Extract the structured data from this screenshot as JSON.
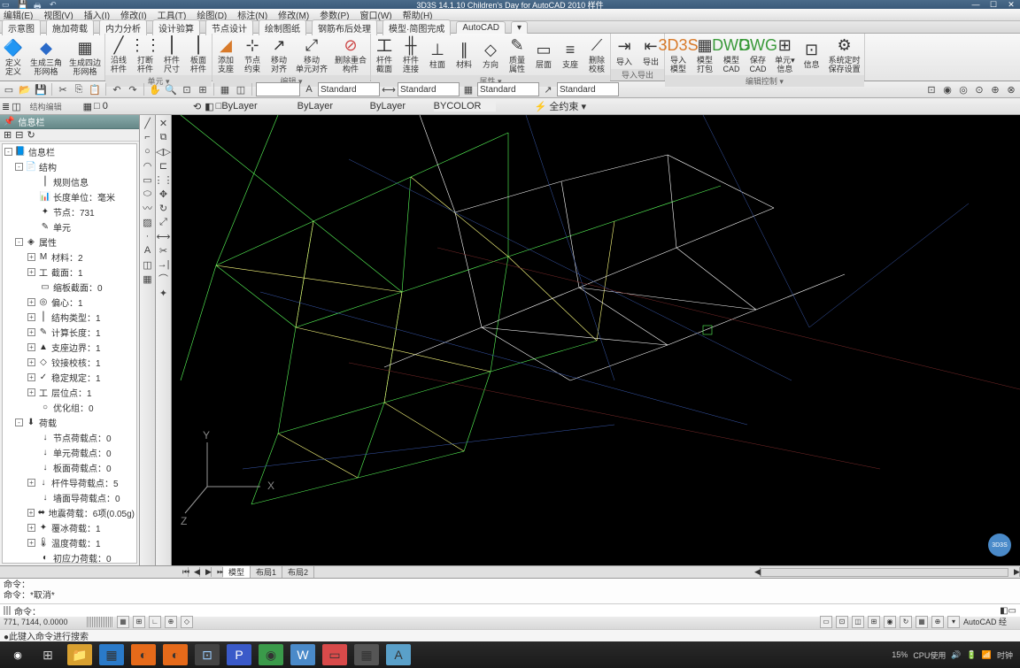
{
  "titlebar": {
    "title": "3D3S 14.1.10 Children's Day for AutoCAD 2010    样件"
  },
  "menubar": {
    "items": [
      "编辑(E)",
      "视图(V)",
      "插入(I)",
      "修改(I)",
      "工具(T)",
      "绘图(D)",
      "标注(N)",
      "修改(M)",
      "参数(P)",
      "窗口(W)",
      "帮助(H)"
    ]
  },
  "tabstrip": {
    "items": [
      "示意图",
      "施加荷载",
      "内力分析",
      "设计验算",
      "节点设计",
      "绘制图纸",
      "钢筋布后处理",
      "模型·简图完成",
      "AutoCAD"
    ]
  },
  "ribbon": {
    "groups": [
      {
        "buttons": [
          {
            "icon": "🔷",
            "label": "定义\n定义",
            "cls": "c-blue"
          },
          {
            "icon": "◆",
            "label": "生成三角\n形网格",
            "cls": "c-blue"
          },
          {
            "icon": "▦",
            "label": "生成四边\n形网格",
            "cls": ""
          }
        ],
        "label": ""
      },
      {
        "buttons": [
          {
            "icon": "╱",
            "label": "沿线\n杆件"
          },
          {
            "icon": "⋮⋮",
            "label": "打断\n杆件"
          },
          {
            "icon": "⎮",
            "label": "杆件\n尺寸"
          },
          {
            "icon": "⎮",
            "label": "板面\n杆件"
          }
        ],
        "label": "单元 ▾"
      },
      {
        "buttons": [
          {
            "icon": "◢",
            "label": "添加\n支座",
            "cls": "c-orange"
          },
          {
            "icon": "⊹",
            "label": "节点\n约束"
          },
          {
            "icon": "↗",
            "label": "移动\n对齐"
          },
          {
            "icon": "⤢",
            "label": "移动\n单元对齐"
          },
          {
            "icon": "⊘",
            "label": "删除重合\n构件",
            "cls": "c-red"
          }
        ],
        "label": "编辑 ▾"
      },
      {
        "buttons": [
          {
            "icon": "工",
            "label": "杆件\n截面"
          },
          {
            "icon": "╫",
            "label": "杆件\n连接"
          },
          {
            "icon": "⊥",
            "label": "柱面"
          },
          {
            "icon": "∥",
            "label": "材料"
          },
          {
            "icon": "◇",
            "label": "方向"
          },
          {
            "icon": "✎",
            "label": "质量\n属性"
          },
          {
            "icon": "▭",
            "label": "层面"
          },
          {
            "icon": "≡",
            "label": "支座"
          },
          {
            "icon": "⟋",
            "label": "删除\n校核"
          }
        ],
        "label": "属性 ▾"
      },
      {
        "buttons": [
          {
            "icon": "⇥",
            "label": "导入"
          },
          {
            "icon": "⇤",
            "label": "导出"
          }
        ],
        "label": "导入导出"
      },
      {
        "buttons": [
          {
            "icon": "3D3S",
            "label": "导入\n模型",
            "cls": "c-orange"
          },
          {
            "icon": "▦",
            "label": "模型\n打包"
          },
          {
            "icon": "DWG",
            "label": "模型\nCAD",
            "cls": "c-green"
          },
          {
            "icon": "DWG",
            "label": "保存\nCAD",
            "cls": "c-green"
          },
          {
            "icon": "⊞",
            "label": "单元▾\n信息"
          },
          {
            "icon": "⊡",
            "label": "信息"
          },
          {
            "icon": "⚙",
            "label": "系统定时\n保存设置"
          }
        ],
        "label": "编辑控制 ▾"
      }
    ]
  },
  "toolbar1": {
    "combos": [
      "",
      "Standard",
      "Standard",
      "Standard",
      "Standard"
    ]
  },
  "toolbar2": {
    "layer_combo": "□ByLayer",
    "layer_value": "□ 0",
    "bylayer1": "ByLayer",
    "bylayer2": "ByLayer",
    "bycolor": "BYCOLOR",
    "constraint_label": "⚡ 全约束 ▾"
  },
  "sidebar": {
    "title": "信息栏",
    "root": "信息栏",
    "items": [
      {
        "depth": 1,
        "exp": "-",
        "ico": "📄",
        "label": "结构"
      },
      {
        "depth": 2,
        "exp": "",
        "ico": "⎮",
        "label": "规则信息"
      },
      {
        "depth": 2,
        "exp": "",
        "ico": "📊",
        "label": "长度单位：毫米"
      },
      {
        "depth": 2,
        "exp": "",
        "ico": "✦",
        "label": "节点：731"
      },
      {
        "depth": 2,
        "exp": "",
        "ico": "✎",
        "label": "单元"
      },
      {
        "depth": 1,
        "exp": "-",
        "ico": "◈",
        "label": "属性"
      },
      {
        "depth": 2,
        "exp": "+",
        "ico": "M",
        "label": "材料：2"
      },
      {
        "depth": 2,
        "exp": "+",
        "ico": "工",
        "label": "截面：1"
      },
      {
        "depth": 2,
        "exp": "",
        "ico": "▭",
        "label": "缩板截面：0"
      },
      {
        "depth": 2,
        "exp": "+",
        "ico": "◎",
        "label": "偏心：1"
      },
      {
        "depth": 2,
        "exp": "+",
        "ico": "⎮",
        "label": "结构类型：1"
      },
      {
        "depth": 2,
        "exp": "+",
        "ico": "✎",
        "label": "计算长度：1"
      },
      {
        "depth": 2,
        "exp": "+",
        "ico": "▲",
        "label": "支座边界：1"
      },
      {
        "depth": 2,
        "exp": "+",
        "ico": "◇",
        "label": "铰接校核：1"
      },
      {
        "depth": 2,
        "exp": "+",
        "ico": "✓",
        "label": "稳定规定：1"
      },
      {
        "depth": 2,
        "exp": "+",
        "ico": "工",
        "label": "层位点：1"
      },
      {
        "depth": 2,
        "exp": "",
        "ico": "○",
        "label": "优化组：0"
      },
      {
        "depth": 1,
        "exp": "-",
        "ico": "⬇",
        "label": "荷载"
      },
      {
        "depth": 2,
        "exp": "",
        "ico": "↓",
        "label": "节点荷载点：0"
      },
      {
        "depth": 2,
        "exp": "",
        "ico": "↓",
        "label": "单元荷载点：0"
      },
      {
        "depth": 2,
        "exp": "",
        "ico": "↓",
        "label": "板面荷载点：0"
      },
      {
        "depth": 2,
        "exp": "+",
        "ico": "↓",
        "label": "杆件导荷载点：5"
      },
      {
        "depth": 2,
        "exp": "",
        "ico": "↓",
        "label": "墙面导荷载点：0"
      },
      {
        "depth": 2,
        "exp": "+",
        "ico": "⬌",
        "label": "地震荷载：6项(0.05g)"
      },
      {
        "depth": 2,
        "exp": "+",
        "ico": "✦",
        "label": "覆冰荷载：1"
      },
      {
        "depth": 2,
        "exp": "+",
        "ico": "🌡",
        "label": "温度荷载：1"
      },
      {
        "depth": 2,
        "exp": "",
        "ico": "◐",
        "label": "初应力荷载：0"
      }
    ]
  },
  "modeltabs": {
    "tabs": [
      "模型",
      "布局1",
      "布局2"
    ]
  },
  "cmd": {
    "hist1": "命令：",
    "hist2": "命令：*取消*",
    "prompt": "命令："
  },
  "statusbar": {
    "coords": "771, 7144,  0.0000",
    "aux": "●此键入命令进行搜索",
    "right_label": "AutoCAD 经"
  },
  "taskbar": {
    "tray": {
      "pct": "15%",
      "cpu": "CPU使用",
      "clock": "时钟"
    }
  },
  "axes": {
    "x": "X",
    "y": "Y",
    "z": "Z"
  }
}
